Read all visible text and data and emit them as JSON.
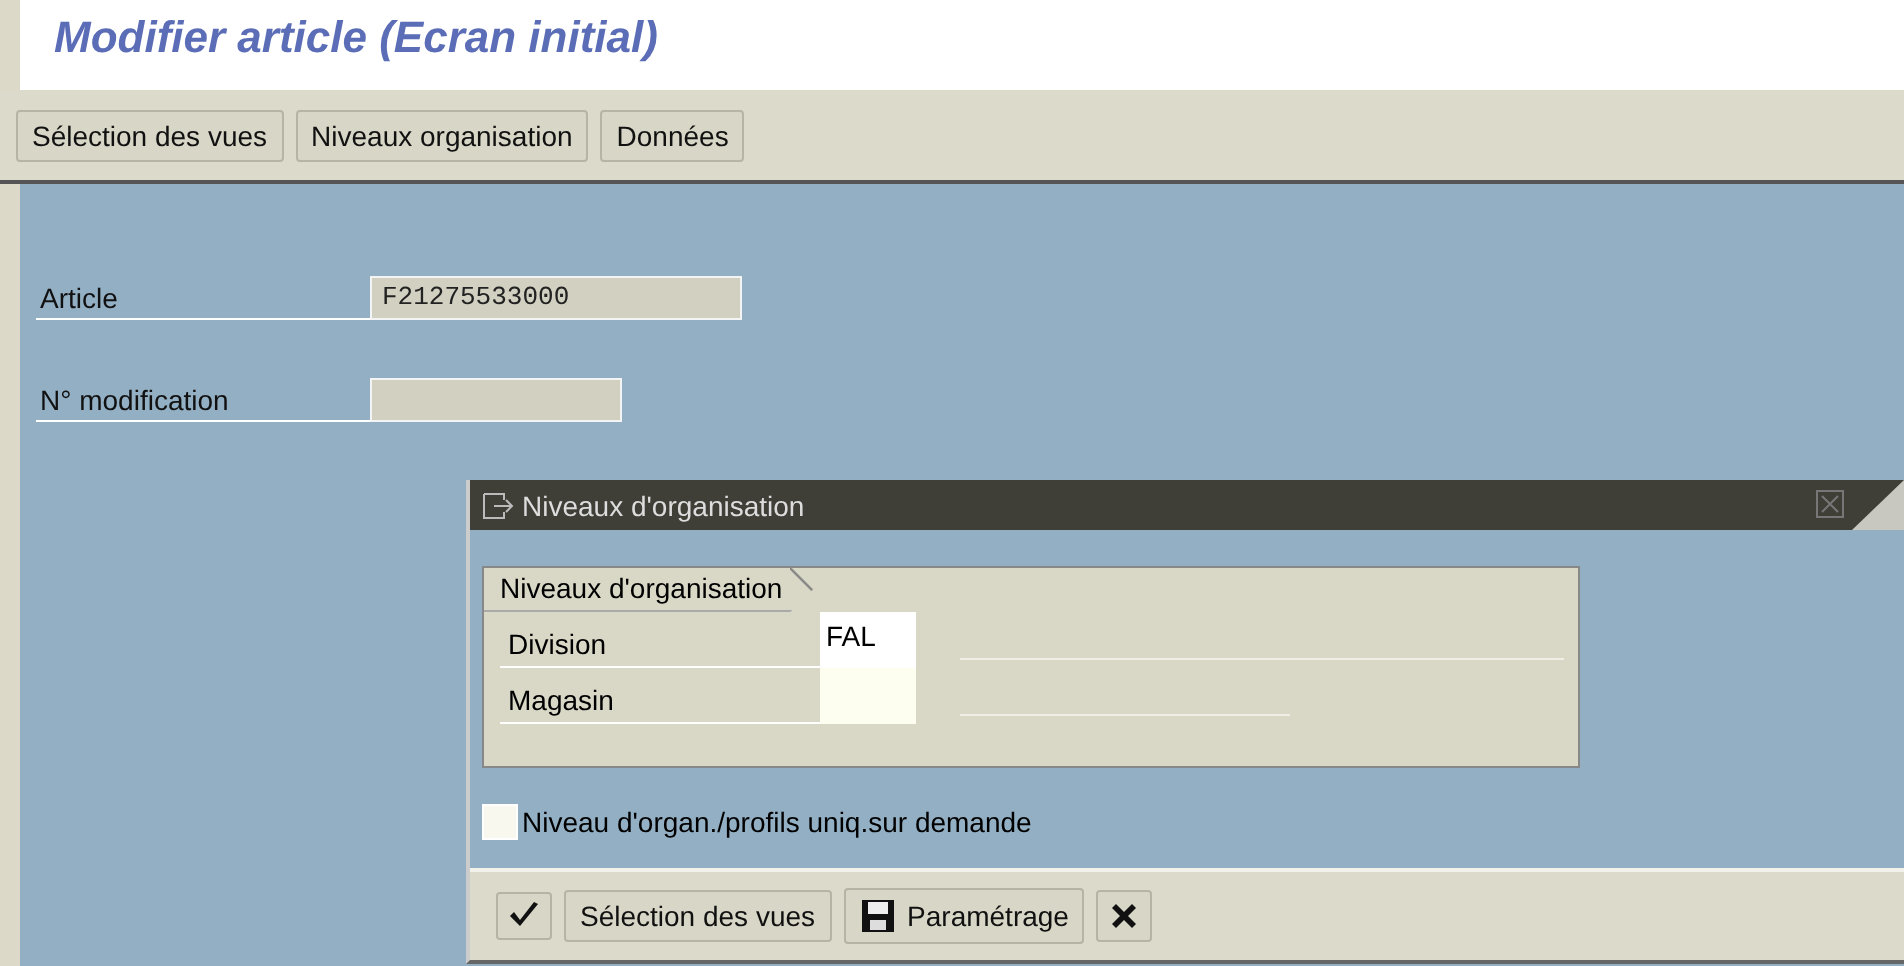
{
  "window": {
    "title": "Modifier article (Ecran initial)"
  },
  "toolbar": [
    "Sélection des vues",
    "Niveaux organisation",
    "Données"
  ],
  "fields": [
    {
      "label": "Article",
      "value": "F21275533000",
      "editable": false
    },
    {
      "label": "N° modification",
      "editable": false
    }
  ],
  "dialog": {
    "title": "Niveaux d'organisation",
    "group": {
      "title": "Niveaux d'organisation",
      "rows": [
        {
          "label": "Division",
          "value": "FAL"
        },
        {
          "label": "Magasin"
        }
      ]
    },
    "checkbox": {
      "label": "Niveau d'organ./profils uniq.sur demande",
      "checked": false
    },
    "buttons": [
      {
        "kind": "confirm"
      },
      {
        "kind": "text",
        "label": "Sélection des vues"
      },
      {
        "kind": "save",
        "label": "Paramétrage"
      },
      {
        "kind": "cancel"
      }
    ]
  }
}
